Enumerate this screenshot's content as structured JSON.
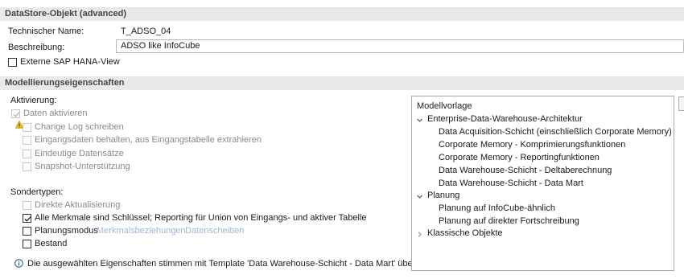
{
  "header": {
    "title": "DataStore-Objekt (advanced)"
  },
  "general": {
    "tech_name_label": "Technischer Name:",
    "tech_name_value": "T_ADSO_04",
    "description_label": "Beschreibung:",
    "description_value": "ADSO like InfoCube",
    "external_hana_view_label": "Externe SAP HANA-View",
    "external_hana_view_checked": false
  },
  "modeling": {
    "title": "Modellierungseigenschaften",
    "activation_label": "Aktivierung:",
    "activation_items": [
      {
        "label": "Daten aktivieren",
        "checked": true,
        "enabled": false
      },
      {
        "label": "Change Log schreiben",
        "checked": false,
        "enabled": false
      },
      {
        "label": "Eingangsdaten behalten, aus Eingangstabelle extrahieren",
        "checked": false,
        "enabled": false
      },
      {
        "label": "Eindeutige Datensätze",
        "checked": false,
        "enabled": false
      },
      {
        "label": "Snapshot-Unterstützung",
        "checked": false,
        "enabled": false
      }
    ],
    "special_types_label": "Sondertypen:",
    "special_items": [
      {
        "label": "Direkte Aktualisierung",
        "checked": false,
        "enabled": false
      },
      {
        "label": "Alle Merkmale sind Schlüssel; Reporting für Union von Eingangs- und aktiver Tabelle",
        "checked": true,
        "enabled": true
      },
      {
        "label": "Planungsmodus",
        "checked": false,
        "enabled": true
      },
      {
        "label": "Bestand",
        "checked": false,
        "enabled": true
      }
    ],
    "links": {
      "characteristic_relationships": "Merkmalsbeziehungen",
      "data_slices": "Datenscheiben"
    },
    "info_text": "Die ausgewählten Eigenschaften stimmen mit Template 'Data Warehouse-Schicht - Data Mart' überein."
  },
  "template_tree": {
    "title": "Modellvorlage",
    "groups": [
      {
        "label": "Enterprise-Data-Warehouse-Architektur",
        "expanded": true,
        "children": [
          "Data Acquisition-Schicht (einschließlich Corporate Memory)",
          "Corporate Memory - Komprimierungsfunktionen",
          "Corporate Memory - Reportingfunktionen",
          "Data Warehouse-Schicht - Deltaberechnung",
          "Data Warehouse-Schicht - Data Mart"
        ]
      },
      {
        "label": "Planung",
        "expanded": true,
        "children": [
          "Planung auf InfoCube-ähnlich",
          "Planung auf direkter Fortschreibung"
        ]
      },
      {
        "label": "Klassische Objekte",
        "expanded": false,
        "children": []
      }
    ]
  }
}
